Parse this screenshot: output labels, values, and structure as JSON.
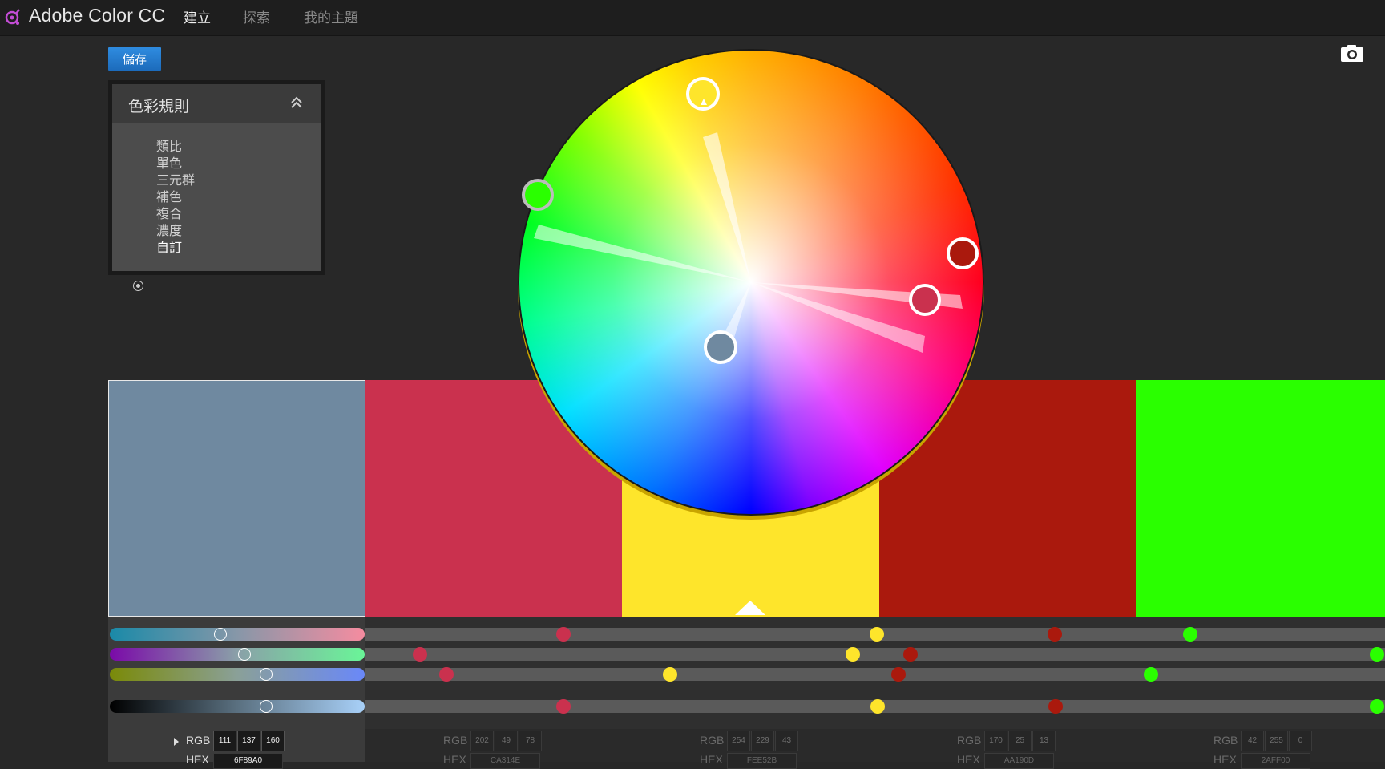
{
  "app": {
    "title": "Adobe Color CC",
    "nav": [
      "建立",
      "探索",
      "我的主題"
    ],
    "active_nav": 0
  },
  "toolbar": {
    "save_label": "儲存",
    "camera_icon": "camera-icon"
  },
  "color_rules": {
    "title": "色彩規則",
    "items": [
      "類比",
      "單色",
      "三元群",
      "補色",
      "複合",
      "濃度",
      "自訂"
    ],
    "selected": "自訂"
  },
  "swatches": [
    {
      "rgb": [
        111,
        137,
        160
      ],
      "hex": "6F89A0",
      "color": "#6f89a0",
      "active": true
    },
    {
      "rgb": [
        202,
        49,
        78
      ],
      "hex": "CA314E",
      "color": "#ca314e",
      "active": false
    },
    {
      "rgb": [
        254,
        229,
        43
      ],
      "hex": "FEE52B",
      "color": "#fee52b",
      "active": false,
      "base": true
    },
    {
      "rgb": [
        170,
        25,
        13
      ],
      "hex": "AA190D",
      "color": "#aa190d",
      "active": false
    },
    {
      "rgb": [
        42,
        255,
        0
      ],
      "hex": "2AFF00",
      "color": "#2aff00",
      "active": false
    }
  ],
  "labels": {
    "rgb": "RGB",
    "hex": "HEX"
  },
  "rgb_values": {
    "s0": {
      "r": "111",
      "g": "137",
      "b": "160",
      "hex": "6F89A0"
    },
    "s1": {
      "r": "202",
      "g": "49",
      "b": "78",
      "hex": "CA314E"
    },
    "s2": {
      "r": "254",
      "g": "229",
      "b": "43",
      "hex": "FEE52B"
    },
    "s3": {
      "r": "170",
      "g": "25",
      "b": "13",
      "hex": "AA190D"
    },
    "s4": {
      "r": "42",
      "g": "255",
      "b": "0",
      "hex": "2AFF00"
    }
  },
  "colors": {
    "accent": "#1e74c8",
    "background": "#282828"
  }
}
